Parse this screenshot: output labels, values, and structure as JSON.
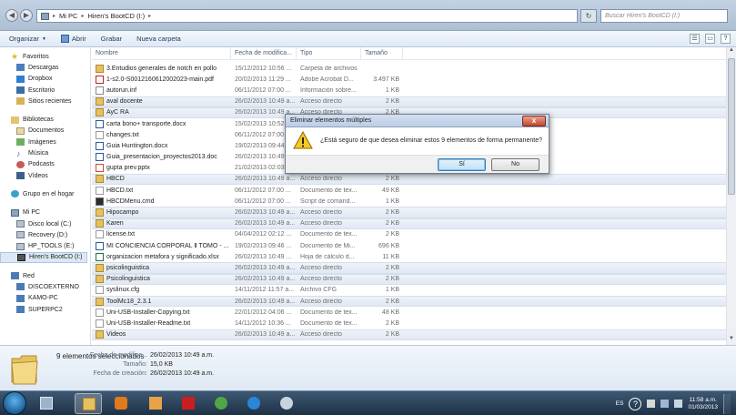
{
  "address": {
    "crumbs": [
      "Mi PC",
      "Hiren's BootCD (I:)"
    ],
    "search_placeholder": "Buscar Hiren's BootCD (I:)"
  },
  "toolbar": {
    "organize": "Organizar",
    "open": "Abrir",
    "burn": "Grabar",
    "new_folder": "Nueva carpeta"
  },
  "nav": {
    "favorites": {
      "label": "Favoritos",
      "items": [
        "Descargas",
        "Dropbox",
        "Escritorio",
        "Sitios recientes"
      ]
    },
    "libraries": {
      "label": "Bibliotecas",
      "items": [
        "Documentos",
        "Imágenes",
        "Música",
        "Podcasts",
        "Vídeos"
      ]
    },
    "homegroup": {
      "label": "Grupo en el hogar"
    },
    "computer": {
      "label": "Mi PC",
      "items": [
        "Disco local (C:)",
        "Recovery (D:)",
        "HP_TOOLS (E:)",
        "Hiren's BootCD (I:)"
      ]
    },
    "network": {
      "label": "Red",
      "items": [
        "DISCOEXTERNO",
        "KAMO-PC",
        "SUPERPC2"
      ]
    }
  },
  "columns": {
    "name": "Nombre",
    "date": "Fecha de modifica...",
    "type": "Tipo",
    "size": "Tamaño"
  },
  "files": [
    {
      "name": "3.Entudios generales de notch en pollo",
      "date": "15/12/2012 10:56 ...",
      "type": "Carpeta de archivos",
      "size": "",
      "icon": "folder",
      "selected": false
    },
    {
      "name": "1-s2.0-S0012160612002023-main.pdf",
      "date": "20/02/2013 11:29 ...",
      "type": "Adobe Acrobat D...",
      "size": "3.497 KB",
      "icon": "pdf",
      "selected": false
    },
    {
      "name": "autorun.inf",
      "date": "06/11/2012 07:00 ...",
      "type": "Información sobre...",
      "size": "1 KB",
      "icon": "inf",
      "selected": false
    },
    {
      "name": "aval docente",
      "date": "26/02/2013 10:49 a...",
      "type": "Acceso directo",
      "size": "2 KB",
      "icon": "shortcut",
      "selected": true
    },
    {
      "name": "AyC RA",
      "date": "26/02/2013 10:49 a...",
      "type": "Acceso directo",
      "size": "2 KB",
      "icon": "shortcut",
      "selected": true
    },
    {
      "name": "carta bono+ transporte.docx",
      "date": "15/02/2013 10:52 ...",
      "type": "",
      "size": "",
      "icon": "doc",
      "selected": false
    },
    {
      "name": "changes.txt",
      "date": "06/11/2012 07:00 ...",
      "type": "",
      "size": "",
      "icon": "txt",
      "selected": false
    },
    {
      "name": "Guia Huntington.docx",
      "date": "19/02/2013 09:44 ...",
      "type": "",
      "size": "",
      "icon": "doc",
      "selected": false
    },
    {
      "name": "Guia_presentacion_proyectos2013.doc",
      "date": "26/02/2013 10:49 ...",
      "type": "",
      "size": "",
      "icon": "doc",
      "selected": false
    },
    {
      "name": "gupta prev.pptx",
      "date": "21/02/2013 02:03 ...",
      "type": "",
      "size": "",
      "icon": "ppt",
      "selected": false
    },
    {
      "name": "HBCD",
      "date": "26/02/2013 10:49 a...",
      "type": "Acceso directo",
      "size": "2 KB",
      "icon": "shortcut",
      "selected": true
    },
    {
      "name": "HBCD.txt",
      "date": "06/11/2012 07:00 ...",
      "type": "Documento de tex...",
      "size": "49 KB",
      "icon": "txt",
      "selected": false
    },
    {
      "name": "HBCDMenu.cmd",
      "date": "06/11/2012 07:00 ...",
      "type": "Script de comand...",
      "size": "1 KB",
      "icon": "cmd",
      "selected": false
    },
    {
      "name": "Hipocampo",
      "date": "26/02/2013 10:49 a...",
      "type": "Acceso directo",
      "size": "2 KB",
      "icon": "shortcut",
      "selected": true
    },
    {
      "name": "Karen",
      "date": "26/02/2013 10:49 a...",
      "type": "Acceso directo",
      "size": "2 KB",
      "icon": "shortcut",
      "selected": true
    },
    {
      "name": "license.txt",
      "date": "04/04/2012 02:12 ...",
      "type": "Documento de tex...",
      "size": "2 KB",
      "icon": "txt",
      "selected": false
    },
    {
      "name": "MI CONCIENCIA CORPORAL Ⅱ TOMO - ...",
      "date": "19/02/2013 09:46 ...",
      "type": "Documento de Mi...",
      "size": "696 KB",
      "icon": "doc",
      "selected": false
    },
    {
      "name": "organizacion metafora y significado.xlsx",
      "date": "26/02/2013 10:49 ...",
      "type": "Hoja de cálculo d...",
      "size": "11 KB",
      "icon": "xls",
      "selected": false
    },
    {
      "name": "psicolinguistica",
      "date": "26/02/2013 10:49 a...",
      "type": "Acceso directo",
      "size": "2 KB",
      "icon": "shortcut",
      "selected": true
    },
    {
      "name": "Psicolinguistica",
      "date": "26/02/2013 10:49 a...",
      "type": "Acceso directo",
      "size": "2 KB",
      "icon": "shortcut",
      "selected": true
    },
    {
      "name": "syslinux.cfg",
      "date": "14/11/2012 11:57 a...",
      "type": "Archivo CFG",
      "size": "1 KB",
      "icon": "cfg",
      "selected": false
    },
    {
      "name": "ToolMc18_2.3.1",
      "date": "26/02/2013 10:49 a...",
      "type": "Acceso directo",
      "size": "2 KB",
      "icon": "shortcut",
      "selected": true
    },
    {
      "name": "Uni-USB-Installer-Copying.txt",
      "date": "22/01/2012 04:06 ...",
      "type": "Documento de tex...",
      "size": "48 KB",
      "icon": "txt",
      "selected": false
    },
    {
      "name": "Uni-USB-Installer-Readme.txt",
      "date": "14/11/2012 10:36 ...",
      "type": "Documento de tex...",
      "size": "2 KB",
      "icon": "txt",
      "selected": false
    },
    {
      "name": "Videos",
      "date": "26/02/2013 10:49 a...",
      "type": "Acceso directo",
      "size": "2 KB",
      "icon": "shortcut",
      "selected": true
    }
  ],
  "details": {
    "count": "9 elementos seleccionados",
    "modified_label": "Fecha de modifica...",
    "modified_value": "26/02/2013 10:49 a.m.",
    "size_label": "Tamaño:",
    "size_value": "15,0 KB",
    "created_label": "Fecha de creación:",
    "created_value": "26/02/2013 10:49 a.m."
  },
  "dialog": {
    "title": "Eliminar elementos múltiples",
    "message": "¿Está seguro de que desea eliminar estos 9 elementos de forma permanente?",
    "yes": "Sí",
    "no": "No",
    "close": "x"
  },
  "taskbar": {
    "lang": "ES",
    "time": "11:58 a.m.",
    "date": "01/03/2013"
  },
  "colors": {
    "accent": "#3c7fb1",
    "taskbar": "#1d3146",
    "selection": "#e1e9f3"
  }
}
